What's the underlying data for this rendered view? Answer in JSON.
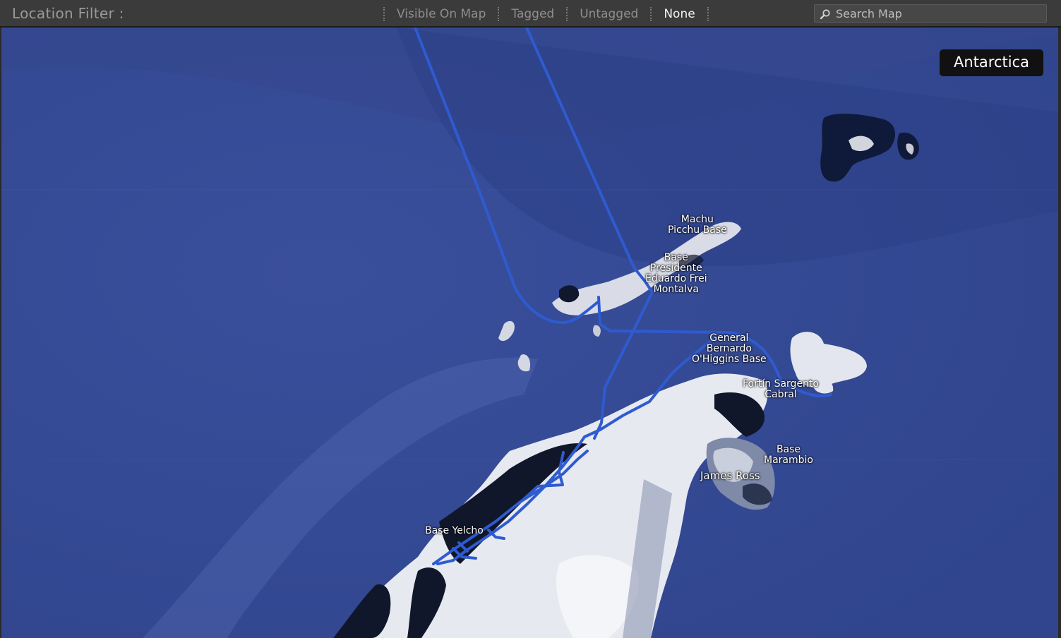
{
  "toolbar": {
    "label": "Location Filter :",
    "filters": [
      {
        "label": "Visible On Map",
        "active": false
      },
      {
        "label": "Tagged",
        "active": false
      },
      {
        "label": "Untagged",
        "active": false
      },
      {
        "label": "None",
        "active": true
      }
    ],
    "search_placeholder": "Search Map",
    "search_icon": "magnifier-icon"
  },
  "map": {
    "region_label": "Antarctica",
    "labels": {
      "machu": "Machu\nPicchu Base",
      "frei": "Base\nPresidente\nEduardo Frei\nMontalva",
      "ohiggins": "General\nBernardo\nO'Higgins Base",
      "fortin": "Fortín Sargento\nCabral",
      "marambio": "Base\nMarambio",
      "james_ross": "James Ross",
      "yelcho": "Base Yelcho"
    },
    "colors": {
      "ocean": "#3d56a6",
      "track": "#2f5bd0",
      "ice": "#e4e6ee",
      "rock": "#101420"
    }
  }
}
